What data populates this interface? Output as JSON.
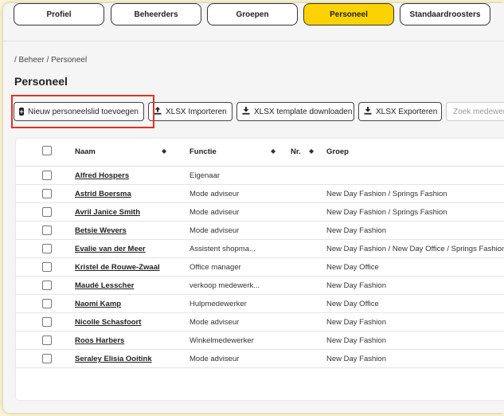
{
  "tabs": [
    {
      "label": "Profiel",
      "active": false
    },
    {
      "label": "Beheerders",
      "active": false
    },
    {
      "label": "Groepen",
      "active": false
    },
    {
      "label": "Personeel",
      "active": true
    },
    {
      "label": "Standaardroosters",
      "active": false
    }
  ],
  "breadcrumb": "/ Beheer / Personeel",
  "page_title": "Personeel",
  "toolbar": {
    "add_label": "Nieuw personeelslid toevoegen",
    "import_label": "XLSX Importeren",
    "template_label": "XLSX template downloaden",
    "export_label": "XLSX Exporteren",
    "search_placeholder": "Zoek medewerker"
  },
  "table": {
    "headers": {
      "name": "Naam",
      "function": "Functie",
      "nr": "Nr.",
      "group": "Groep"
    },
    "rows": [
      {
        "name": "Alfred Hospers",
        "function": "Eigenaar",
        "nr": "",
        "group": ""
      },
      {
        "name": "Astrid Boersma",
        "function": "Mode adviseur",
        "nr": "",
        "group": "New Day Fashion / Springs Fashion"
      },
      {
        "name": "Avril Janice Smith",
        "function": "Mode adviseur",
        "nr": "",
        "group": "New Day Fashion / Springs Fashion"
      },
      {
        "name": "Betsie Wevers",
        "function": "Mode adviseur",
        "nr": "",
        "group": "New Day Fashion"
      },
      {
        "name": "Evalie van der Meer",
        "function": "Assistent shopma...",
        "nr": "",
        "group": "New Day Fashion / New Day Office / Springs Fashion"
      },
      {
        "name": "Kristel de Rouwe-Zwaal",
        "function": "Office manager",
        "nr": "",
        "group": "New Day Office"
      },
      {
        "name": "Maudé Lesscher",
        "function": "verkoop medewerk...",
        "nr": "",
        "group": "New Day Fashion"
      },
      {
        "name": "Naomi Kamp",
        "function": "Hulpmedewerker",
        "nr": "",
        "group": "New Day Office"
      },
      {
        "name": "Nicolle Schasfoort",
        "function": "Mode adviseur",
        "nr": "",
        "group": "New Day Fashion"
      },
      {
        "name": "Roos Harbers",
        "function": "Winkelmedewerker",
        "nr": "",
        "group": "New Day Fashion"
      },
      {
        "name": "Seraley Elisia Ooitink",
        "function": "Mode adviseur",
        "nr": "",
        "group": "New Day Fashion"
      }
    ]
  },
  "colors": {
    "accent": "#fcd300",
    "highlight": "#e53120",
    "background": "#fdf6d3"
  }
}
